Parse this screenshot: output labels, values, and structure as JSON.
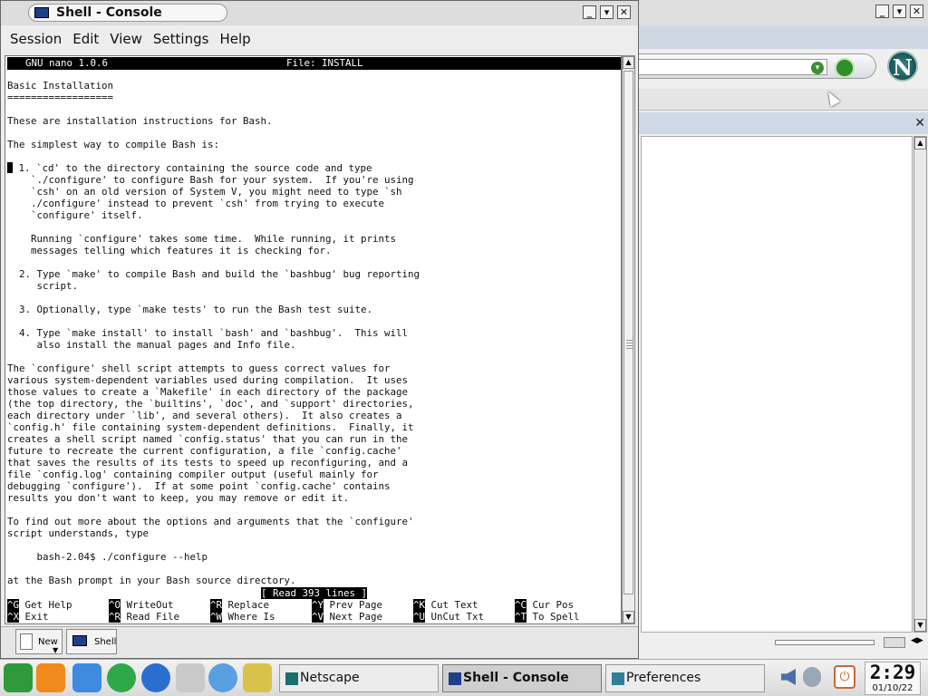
{
  "background_window": {
    "title_controls": [
      "_",
      "▾",
      "✕"
    ],
    "panel_close": "✕",
    "logo_letter": "N"
  },
  "shell_window": {
    "title": "Shell - Console",
    "title_controls": [
      "_",
      "▾",
      "✕"
    ],
    "menu": [
      "Session",
      "Edit",
      "View",
      "Settings",
      "Help"
    ],
    "nano": {
      "version": "GNU nano 1.0.6",
      "file": "File: INSTALL",
      "lines": [
        "Basic Installation",
        "==================",
        "",
        "These are installation instructions for Bash.",
        "",
        "The simplest way to compile Bash is:",
        "",
        " 1. `cd' to the directory containing the source code and type",
        "    `./configure' to configure Bash for your system.  If you're using",
        "    `csh' on an old version of System V, you might need to type `sh",
        "    ./configure' instead to prevent `csh' from trying to execute",
        "    `configure' itself.",
        "",
        "    Running `configure' takes some time.  While running, it prints",
        "    messages telling which features it is checking for.",
        "",
        "  2. Type `make' to compile Bash and build the `bashbug' bug reporting",
        "     script.",
        "",
        "  3. Optionally, type `make tests' to run the Bash test suite.",
        "",
        "  4. Type `make install' to install `bash' and `bashbug'.  This will",
        "     also install the manual pages and Info file.",
        "",
        "The `configure' shell script attempts to guess correct values for",
        "various system-dependent variables used during compilation.  It uses",
        "those values to create a `Makefile' in each directory of the package",
        "(the top directory, the `builtins', `doc', and `support' directories,",
        "each directory under `lib', and several others).  It also creates a",
        "`config.h' file containing system-dependent definitions.  Finally, it",
        "creates a shell script named `config.status' that you can run in the",
        "future to recreate the current configuration, a file `config.cache'",
        "that saves the results of its tests to speed up reconfiguring, and a",
        "file `config.log' containing compiler output (useful mainly for",
        "debugging `configure').  If at some point `config.cache' contains",
        "results you don't want to keep, you may remove or edit it.",
        "",
        "To find out more about the options and arguments that the `configure'",
        "script understands, type",
        "",
        "     bash-2.04$ ./configure --help",
        "",
        "at the Bash prompt in your Bash source directory."
      ],
      "status": "[ Read 393 lines ]",
      "shortcuts": [
        {
          "key": "^G",
          "label": "Get Help"
        },
        {
          "key": "^O",
          "label": "WriteOut"
        },
        {
          "key": "^R",
          "label": "Replace"
        },
        {
          "key": "^Y",
          "label": "Prev Page"
        },
        {
          "key": "^K",
          "label": "Cut Text"
        },
        {
          "key": "^C",
          "label": "Cur Pos"
        },
        {
          "key": "^X",
          "label": "Exit"
        },
        {
          "key": "^R",
          "label": "Read File"
        },
        {
          "key": "^W",
          "label": "Where Is"
        },
        {
          "key": "^V",
          "label": "Next Page"
        },
        {
          "key": "^U",
          "label": "UnCut Txt"
        },
        {
          "key": "^T",
          "label": "To Spell"
        }
      ]
    },
    "tabs": {
      "new": "New",
      "shell": "Shell"
    }
  },
  "taskbar": {
    "tasks": [
      {
        "label": "Netscape",
        "active": false
      },
      {
        "label": "Shell - Console",
        "active": true
      },
      {
        "label": "Preferences",
        "active": false
      }
    ],
    "clock_time": "2:29",
    "clock_date": "01/10/22",
    "launcher_icons": [
      "suse-logo-icon",
      "life-vest-icon",
      "cube-icon",
      "runner-icon",
      "globe-icon",
      "file-cabinet-icon",
      "help-running-icon",
      "office-brush-icon"
    ]
  },
  "colors": {
    "desktop": "#e9e9e9",
    "terminal_bg": "#ffffff",
    "nano_bar": "#000000"
  }
}
